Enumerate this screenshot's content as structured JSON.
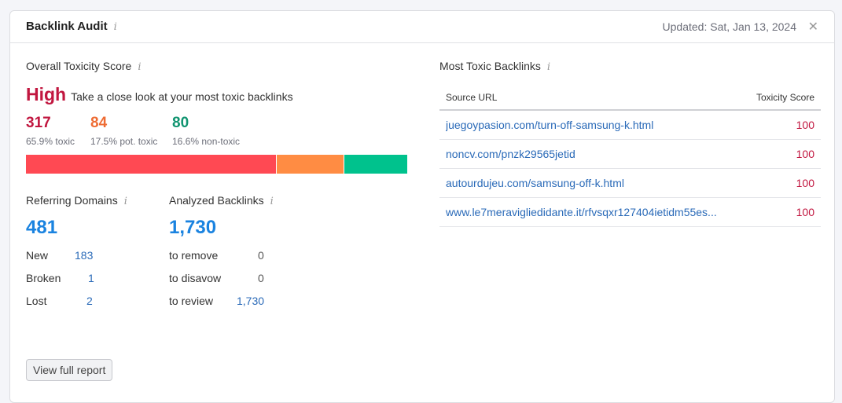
{
  "header": {
    "title": "Backlink Audit",
    "updated": "Updated: Sat, Jan 13, 2024",
    "close_symbol": "✕"
  },
  "toxicity": {
    "label": "Overall Toxicity Score",
    "level": "High",
    "description": "Take a close look at your most toxic backlinks",
    "toxic": {
      "count": "317",
      "label": "65.9% toxic",
      "color": "#c1163f",
      "share": 65.9
    },
    "pot_toxic": {
      "count": "84",
      "label": "17.5% pot. toxic",
      "color": "#ee6c34",
      "share": 17.5
    },
    "non_toxic": {
      "count": "80",
      "label": "16.6% non-toxic",
      "color": "#109470",
      "share": 16.6
    },
    "bar_colors": {
      "toxic": "#ff4953",
      "pot_toxic": "#ff8c43",
      "non_toxic": "#00c28d"
    }
  },
  "referring_domains": {
    "label": "Referring Domains",
    "total": "481",
    "rows": [
      {
        "key": "New",
        "value": "183"
      },
      {
        "key": "Broken",
        "value": "1"
      },
      {
        "key": "Lost",
        "value": "2"
      }
    ]
  },
  "analyzed_backlinks": {
    "label": "Analyzed Backlinks",
    "total": "1,730",
    "rows": [
      {
        "key": "to remove",
        "value": "0"
      },
      {
        "key": "to disavow",
        "value": "0"
      },
      {
        "key": "to review",
        "value": "1,730"
      }
    ]
  },
  "most_toxic": {
    "label": "Most Toxic Backlinks",
    "col_source": "Source URL",
    "col_score": "Toxicity Score",
    "rows": [
      {
        "url": "juegoypasion.com/turn-off-samsung-k.html",
        "score": "100"
      },
      {
        "url": "noncv.com/pnzk29565jetid",
        "score": "100"
      },
      {
        "url": "autourdujeu.com/samsung-off-k.html",
        "score": "100"
      },
      {
        "url": "www.le7meravigliedidante.it/rfvsqxr127404ietidm55es...",
        "score": "100"
      }
    ]
  },
  "view_full_report": "View full report",
  "info_glyph": "i"
}
